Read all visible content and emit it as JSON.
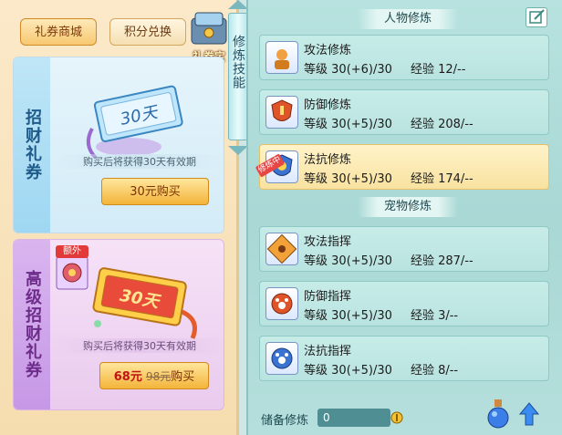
{
  "shop": {
    "tabs": [
      {
        "label": "礼券商城",
        "active": true
      },
      {
        "label": "积分兑换",
        "active": false
      }
    ],
    "corner_label": "礼券宝",
    "cards": [
      {
        "title": "招财礼券",
        "duration_badge": "30天",
        "description": "购买后将获得30天有效期",
        "button_label": "30元购买"
      },
      {
        "title": "高级招财礼券",
        "extra_label": "额外",
        "duration_badge": "30天",
        "description": "购买后将获得30天有效期",
        "sale_price": "68元",
        "original_price": "98元",
        "button_suffix": "购买"
      }
    ]
  },
  "side_tab": {
    "label": "修炼技能"
  },
  "panel": {
    "person_section": "人物修炼",
    "pet_section": "宠物修炼",
    "level_label": "等级",
    "exp_label": "经验",
    "person_items": [
      {
        "name": "攻法修炼",
        "level": "30(+6)/30",
        "exp": "12/--",
        "icon": "attack-cultivation-icon",
        "selected": false
      },
      {
        "name": "防御修炼",
        "level": "30(+5)/30",
        "exp": "208/--",
        "icon": "defense-cultivation-icon",
        "selected": false
      },
      {
        "name": "法抗修炼",
        "level": "30(+5)/30",
        "exp": "174/--",
        "icon": "resist-cultivation-icon",
        "selected": true,
        "tag": "修炼中"
      }
    ],
    "pet_items": [
      {
        "name": "攻法指挥",
        "level": "30(+5)/30",
        "exp": "287/--",
        "icon": "pet-attack-icon"
      },
      {
        "name": "防御指挥",
        "level": "30(+5)/30",
        "exp": "3/--",
        "icon": "pet-defense-icon"
      },
      {
        "name": "法抗指挥",
        "level": "30(+5)/30",
        "exp": "8/--",
        "icon": "pet-resist-icon"
      }
    ],
    "reserve_label": "储备修炼",
    "reserve_value": "0"
  }
}
